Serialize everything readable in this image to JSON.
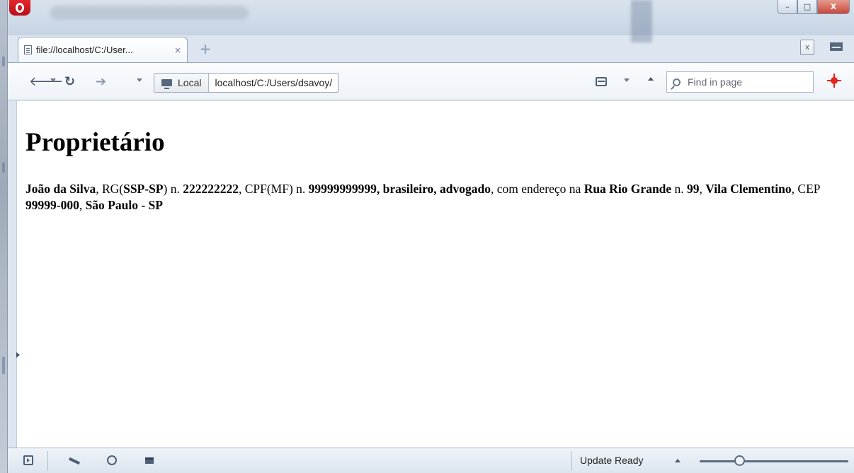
{
  "browser": {
    "tab": {
      "title": "file://localhost/C:/User...",
      "close": "×"
    },
    "new_tab": "+",
    "trash": "x",
    "window_controls": {
      "minimize": "–",
      "maximize": "□",
      "close": "X"
    }
  },
  "toolbar": {
    "back": "🡐",
    "reload": "↻",
    "forward": "➔",
    "address_badge": "Local",
    "address_text": "localhost/C:/Users/dsavoy/",
    "find_placeholder": "Find in page"
  },
  "content": {
    "heading": "Proprietário",
    "paragraph": {
      "name": "João da Silva",
      "rg_prefix": ", RG(",
      "rg_org": "SSP-SP",
      "rg_mid": ") n. ",
      "rg_number": "222222222",
      "cpf_prefix": ", CPF(MF) n. ",
      "cpf_number": "99999999999",
      "nationality_prefix": ", ",
      "nationality": "brasileiro",
      "profession_prefix": ", ",
      "profession": "advogado",
      "address_prefix": ", com endereço na ",
      "street": "Rua Rio Grande",
      "number_prefix": " n. ",
      "number": "99",
      "district_prefix": ", ",
      "district": "Vila Clementino",
      "cep_prefix": ", CEP ",
      "cep": "99999-000",
      "city_prefix": ", ",
      "city": "São Paulo - SP"
    }
  },
  "statusbar": {
    "update_label": "Update Ready",
    "zoom_fraction": 0.27
  },
  "icons": {
    "panel": "panel-toggle-icon",
    "unite": "opera-unite-icon",
    "globe": "web-globe-icon",
    "windows": "windows-icon",
    "bug": "debug-icon",
    "reader": "reader-view-icon"
  },
  "colors": {
    "opera_red": "#e1261c",
    "content_bg": "#ffffff",
    "chrome_bg": "#dde6f0"
  }
}
